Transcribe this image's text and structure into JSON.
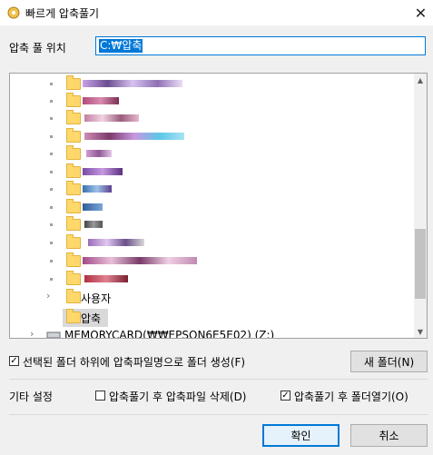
{
  "window": {
    "title": "빠르게 압축풀기",
    "close_label": "✕"
  },
  "path": {
    "label": "압축 풀 위치",
    "value": "C:₩압축"
  },
  "tree": {
    "items": [
      {
        "label": "사용자"
      },
      {
        "label": "압축"
      },
      {
        "label": "MEMORYCARD(₩₩EPSON6E5E02) (Z:)"
      }
    ],
    "scroll_up": "▲",
    "scroll_down": "▼",
    "chevron": "›"
  },
  "options": {
    "create_folder_label": "선택된 폴더 하위에 압축파일명으로 폴더 생성(F)",
    "create_folder_checked": true,
    "new_folder_button": "새 폴더(N)",
    "other_label": "기타 설정",
    "delete_after_label": "압축풀기 후 압축파일 삭제(D)",
    "delete_after_checked": false,
    "open_folder_label": "압축풀기 후 폴더열기(O)",
    "open_folder_checked": true
  },
  "buttons": {
    "ok": "확인",
    "cancel": "취소"
  }
}
